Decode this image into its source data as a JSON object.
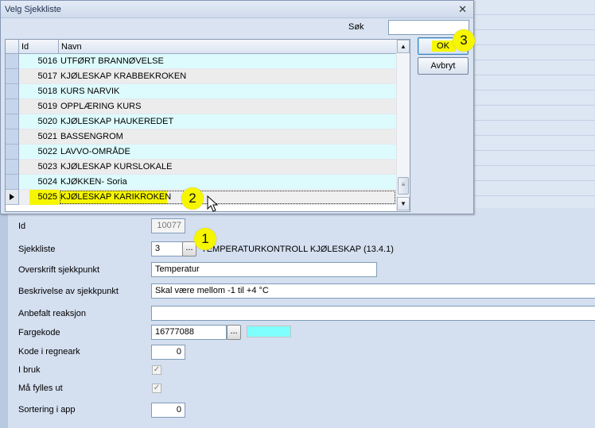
{
  "dialog": {
    "title": "Velg Sjekkliste",
    "search_label": "Søk",
    "search_value": "",
    "columns": [
      "Id",
      "Navn"
    ],
    "rows": [
      {
        "id": "5016",
        "name": "UTFØRT BRANNØVELSE"
      },
      {
        "id": "5017",
        "name": "KJØLESKAP KRABBEKROKEN"
      },
      {
        "id": "5018",
        "name": "KURS NARVIK"
      },
      {
        "id": "5019",
        "name": "OPPLÆRING KURS"
      },
      {
        "id": "5020",
        "name": "KJØLESKAP HAUKEREDET"
      },
      {
        "id": "5021",
        "name": "BASSENGROM"
      },
      {
        "id": "5022",
        "name": "LAVVO-OMRÅDE"
      },
      {
        "id": "5023",
        "name": "KJØLESKAP KURSLOKALE"
      },
      {
        "id": "5024",
        "name": "KJØKKEN- Soria"
      },
      {
        "id": "5025",
        "name": "KJØLESKAP KARIKROKEN"
      }
    ],
    "selected_row": 9,
    "ok_label": "OK",
    "cancel_label": "Avbryt",
    "close_glyph": "✕"
  },
  "form": {
    "id_label": "Id",
    "id_value": "10077",
    "sjekkliste_label": "Sjekkliste",
    "sjekkliste_value": "3",
    "sjekkliste_name": "TEMPERATURKONTROLL KJØLESKAP (13.4.1)",
    "overskrift_label": "Overskrift sjekkpunkt",
    "overskrift_value": "Temperatur",
    "beskrivelse_label": "Beskrivelse av sjekkpunkt",
    "beskrivelse_value": "Skal være mellom -1 til +4 °C",
    "anbefalt_label": "Anbefalt reaksjon",
    "anbefalt_value": "",
    "fargekode_label": "Fargekode",
    "fargekode_value": "16777088",
    "fargekode_color": "#80ffff",
    "kode_label": "Kode i regneark",
    "kode_value": "0",
    "ibruk_label": "I bruk",
    "ibruk_checked": true,
    "mafylles_label": "Må fylles ut",
    "mafylles_checked": true,
    "sortering_label": "Sortering i app",
    "sortering_value": "0",
    "dots_label": "..."
  },
  "callouts": {
    "one": "1",
    "two": "2",
    "three": "3"
  },
  "colors": {
    "highlight": "#f6f600",
    "row_alt": "#ddfbfd",
    "selector": "#c4d5ec"
  }
}
